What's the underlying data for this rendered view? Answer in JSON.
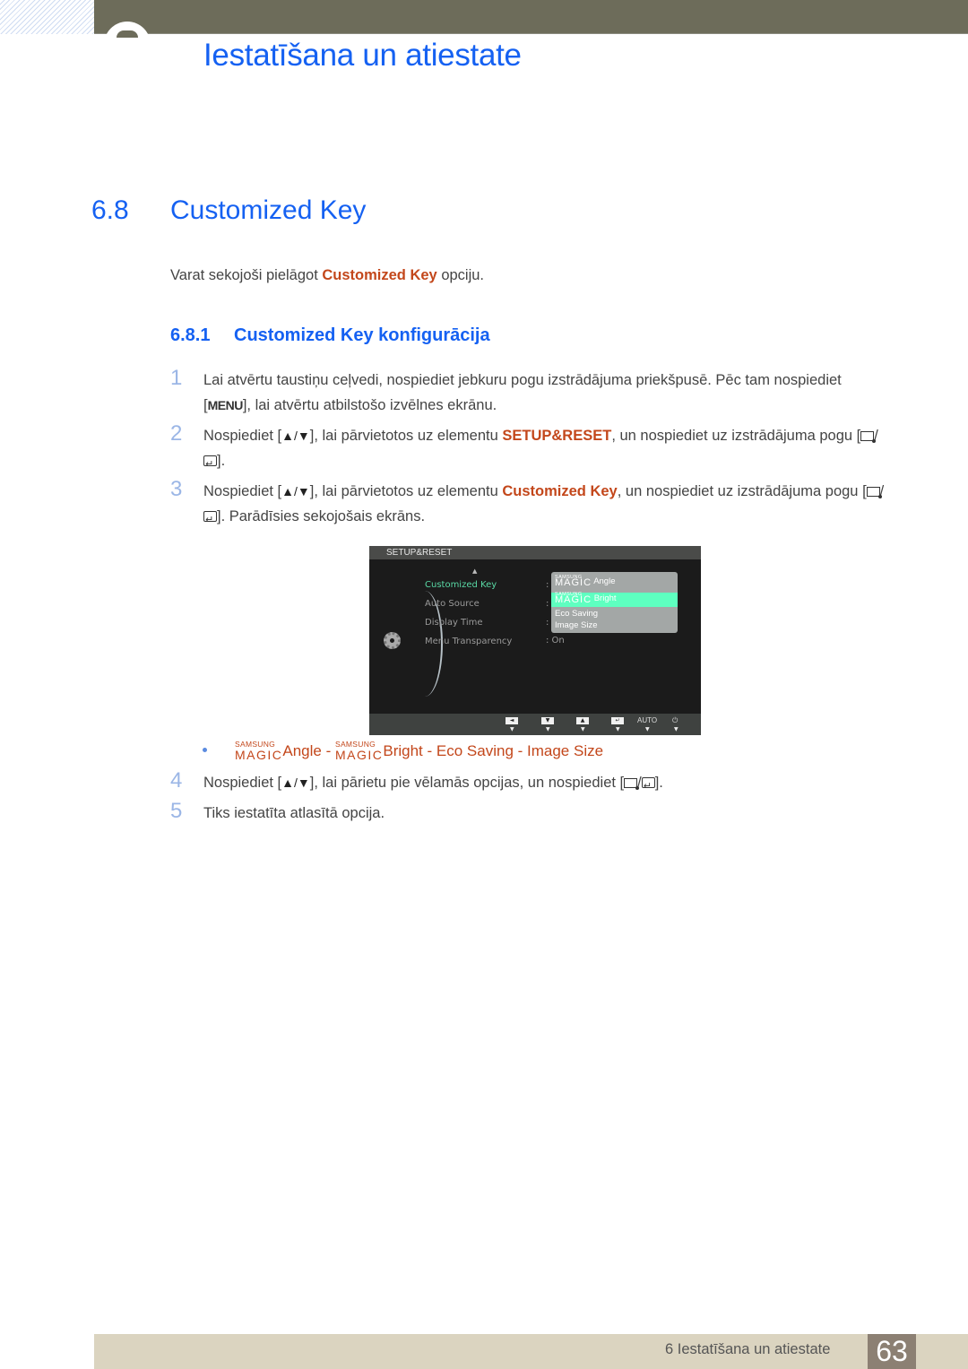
{
  "header": {
    "chapter_title": "Iestatīšana un atiestate"
  },
  "section": {
    "number": "6.8",
    "title": "Customized Key",
    "intro_before": "Varat sekojoši pielāgot ",
    "intro_highlight": "Customized Key",
    "intro_after": " opciju."
  },
  "subsection": {
    "number": "6.8.1",
    "title": "Customized Key konfigurācija"
  },
  "steps": [
    {
      "num": "1",
      "text_a": "Lai atvērtu taustiņu ceļvedi, nospiediet jebkuru pogu izstrādājuma priekšpusē. Pēc tam nospiediet [",
      "key": "MENU",
      "text_b": "], lai atvērtu atbilstošo izvēlnes ekrānu."
    },
    {
      "num": "2",
      "text_a": "Nospiediet [",
      "text_b": "], lai pārvietotos uz elementu ",
      "highlight": "SETUP&RESET",
      "text_c": ", un nospiediet uz izstrādājuma pogu [",
      "text_d": "]."
    },
    {
      "num": "3",
      "text_a": "Nospiediet [",
      "text_b": "], lai pārvietotos uz elementu ",
      "highlight": "Customized Key",
      "text_c": ", un nospiediet uz izstrādājuma pogu [",
      "text_d": "]. Parādīsies sekojošais ekrāns."
    },
    {
      "num": "4",
      "text_a": "Nospiediet [",
      "text_b": "], lai pārietu pie vēlamās opcijas, un nospiediet [",
      "text_c": "]."
    },
    {
      "num": "5",
      "text_a": "Tiks iestatīta atlasītā opcija."
    }
  ],
  "symbols": {
    "up_down": "▲/▼",
    "slash": "/"
  },
  "osd": {
    "title": "SETUP&RESET",
    "items": [
      {
        "label": "Customized Key",
        "colon": ":",
        "value": "",
        "active": true
      },
      {
        "label": "Auto Source",
        "colon": ":",
        "value": ""
      },
      {
        "label": "Display Time",
        "colon": ":",
        "value": ""
      },
      {
        "label": "Menu Transparency",
        "colon": "",
        "value": ": On"
      }
    ],
    "dropdown": [
      {
        "brand_top": "SAMSUNG",
        "brand": "MAGIC",
        "label": "Angle"
      },
      {
        "brand_top": "SAMSUNG",
        "brand": "MAGIC",
        "label": "Bright",
        "selected": true
      },
      {
        "label": "Eco Saving"
      },
      {
        "label": "Image Size"
      }
    ],
    "buttons": [
      "◄",
      "▼",
      "▲",
      "↵",
      "AUTO",
      "⏻"
    ],
    "accent_color": "#59d9a5",
    "selected_color": "#5effc0"
  },
  "options_line": {
    "brand_top": "SAMSUNG",
    "brand": "MAGIC",
    "opt1": "Angle",
    "sep": " - ",
    "opt2": "Bright",
    "opt3": "Eco Saving",
    "opt4": "Image Size"
  },
  "footer": {
    "chapter_label": "6 Iestatīšana un atiestate",
    "page_number": "63"
  },
  "colors": {
    "heading_blue": "#1561f2",
    "highlight_orange": "#c3471b",
    "header_bar": "#6d6c5a",
    "footer_bar": "#dbd4c0",
    "page_box": "#8c8073"
  }
}
